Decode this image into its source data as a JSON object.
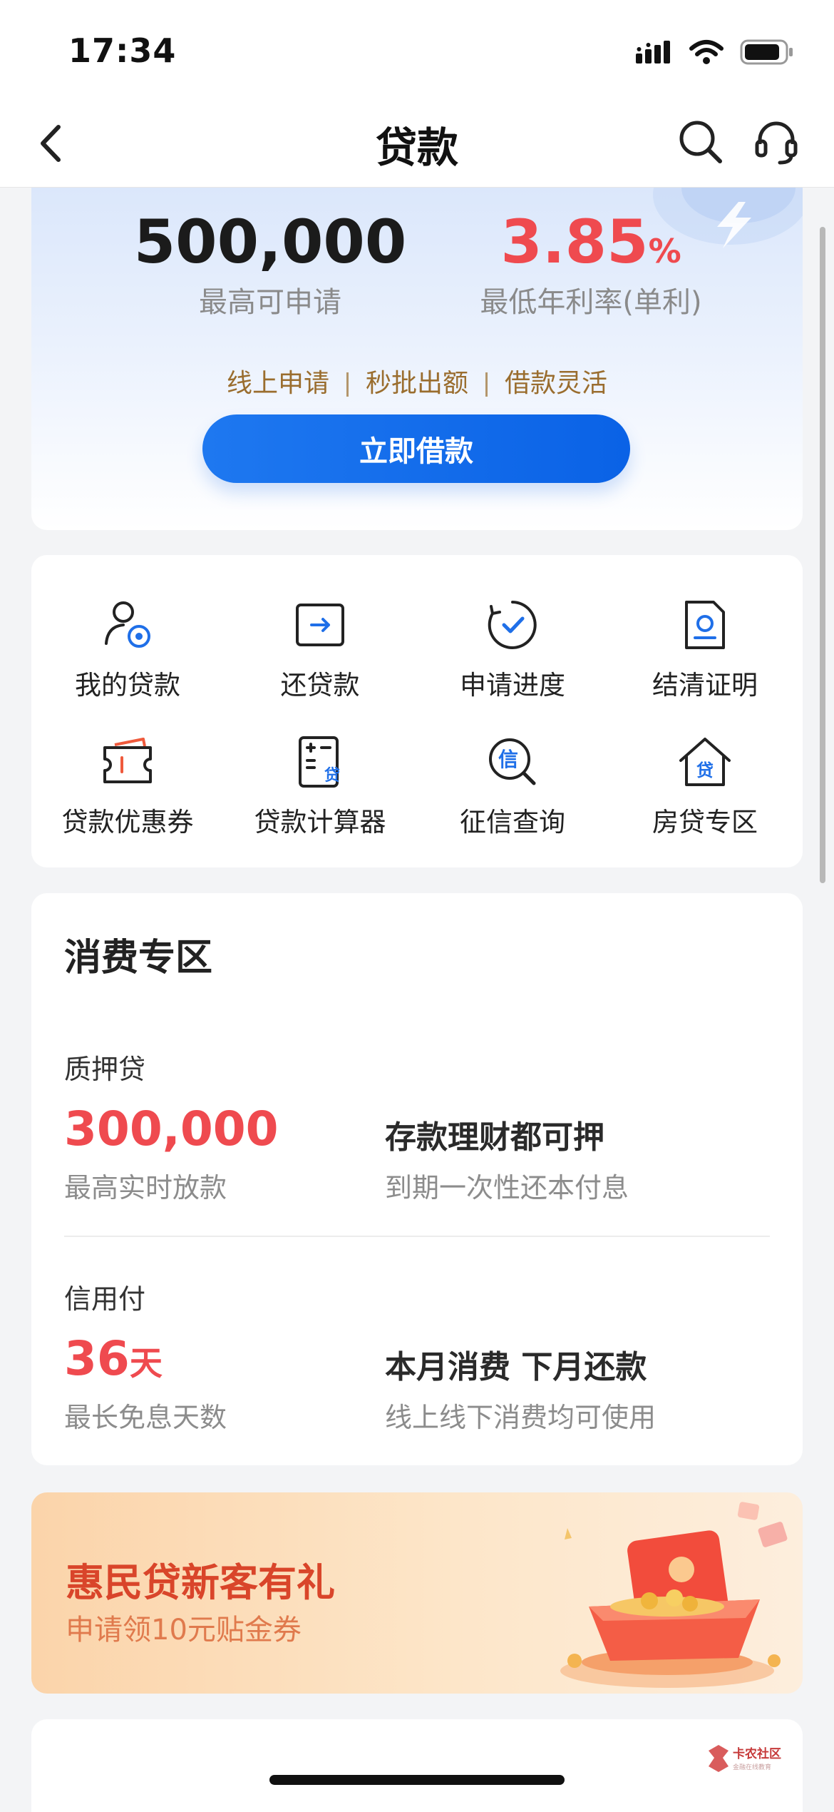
{
  "status_bar": {
    "time": "17:34"
  },
  "nav": {
    "title": "贷款"
  },
  "hero": {
    "max_amount": "500,000",
    "max_amount_label": "最高可申请",
    "min_rate_value": "3.85",
    "min_rate_unit": "%",
    "min_rate_label": "最低年利率(单利)",
    "features": [
      "线上申请",
      "秒批出额",
      "借款灵活"
    ],
    "cta_label": "立即借款"
  },
  "quick_menu": [
    {
      "label": "我的贷款",
      "icon": "user-coin-icon"
    },
    {
      "label": "还贷款",
      "icon": "repay-card-icon"
    },
    {
      "label": "申请进度",
      "icon": "progress-check-icon"
    },
    {
      "label": "结清证明",
      "icon": "certificate-icon"
    },
    {
      "label": "贷款优惠券",
      "icon": "coupon-icon"
    },
    {
      "label": "贷款计算器",
      "icon": "calculator-icon"
    },
    {
      "label": "征信查询",
      "icon": "credit-search-icon"
    },
    {
      "label": "房贷专区",
      "icon": "house-loan-icon"
    }
  ],
  "consume": {
    "title": "消费专区",
    "products": [
      {
        "name": "质押贷",
        "value": "300,000",
        "unit": "",
        "value_label": "最高实时放款",
        "headline": "存款理财都可押",
        "desc": "到期一次性还本付息"
      },
      {
        "name": "信用付",
        "value": "36",
        "unit": "天",
        "value_label": "最长免息天数",
        "headline": "本月消费 下月还款",
        "desc": "线上线下消费均可使用"
      }
    ]
  },
  "promo": {
    "title": "惠民贷新客有礼",
    "subtitle": "申请领10元贴金券"
  },
  "watermark": {
    "title": "卡农社区",
    "subtitle": "金融在线教育"
  },
  "colors": {
    "accent": "#0a62e6",
    "red": "#ef4a4f",
    "gold": "#9a6d2e",
    "promo": "#d9452a"
  }
}
